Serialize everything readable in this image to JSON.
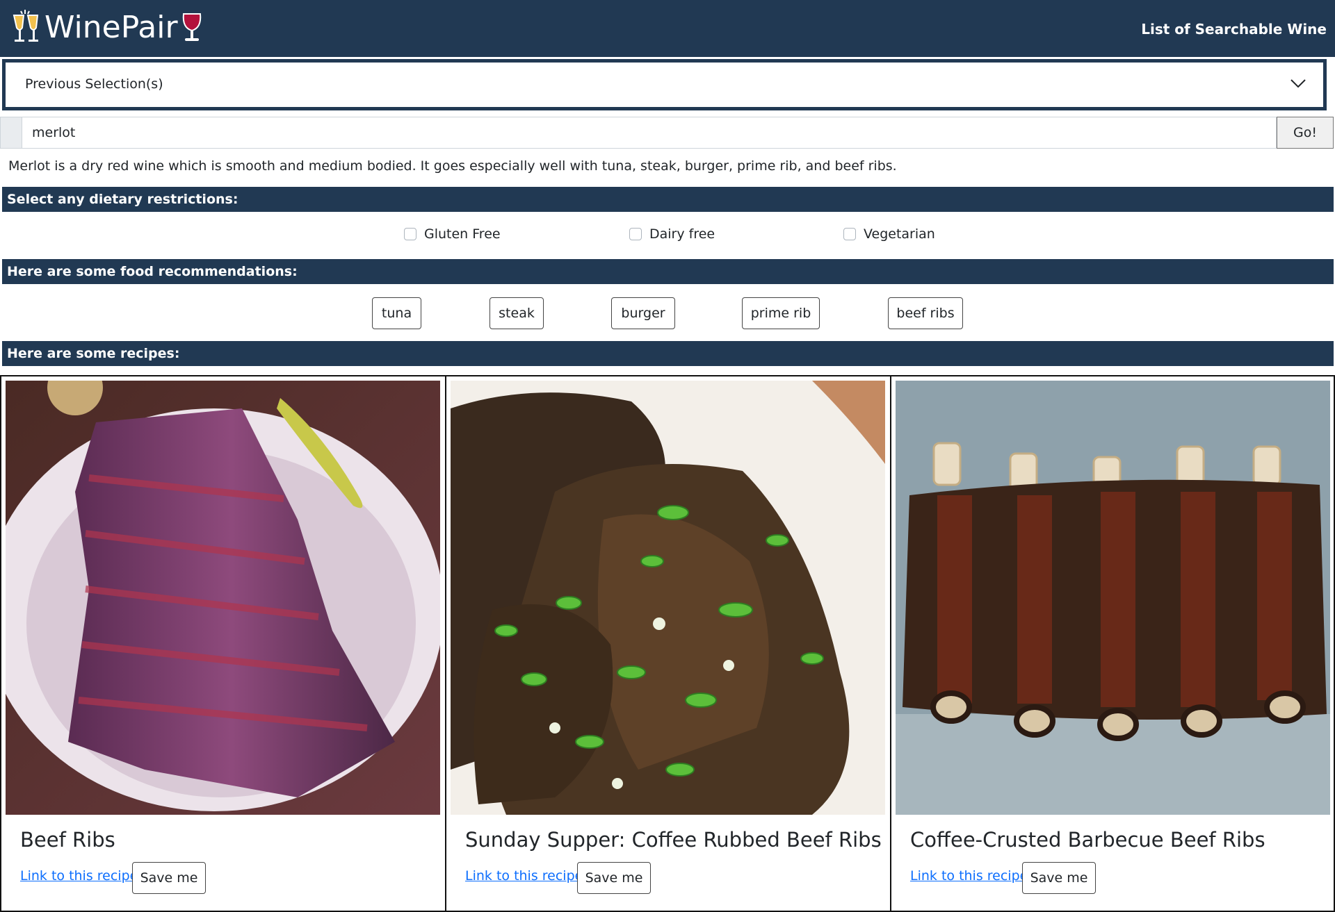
{
  "header": {
    "brand": "WinePair",
    "nav_link": "List of Searchable Wine"
  },
  "previous_selection": {
    "label": "Previous Selection(s)"
  },
  "search": {
    "value": "merlot",
    "go_label": "Go!"
  },
  "description": "Merlot is a dry red wine which is smooth and medium bodied. It goes especially well with tuna, steak, burger, prime rib, and beef ribs.",
  "dietary": {
    "heading": "Select any dietary restrictions:",
    "options": [
      {
        "label": "Gluten Free",
        "checked": false
      },
      {
        "label": "Dairy free",
        "checked": false
      },
      {
        "label": "Vegetarian",
        "checked": false
      }
    ]
  },
  "food": {
    "heading": "Here are some food recommendations:",
    "items": [
      "tuna",
      "steak",
      "burger",
      "prime rib",
      "beef ribs"
    ]
  },
  "recipes": {
    "heading": "Here are some recipes:",
    "cards": [
      {
        "title": "Beef Ribs",
        "link_label": "Link to this recipe",
        "save_label": "Save me"
      },
      {
        "title": "Sunday Supper: Coffee Rubbed Beef Ribs",
        "link_label": "Link to this recipe",
        "save_label": "Save me"
      },
      {
        "title": "Coffee-Crusted Barbecue Beef Ribs",
        "link_label": "Link to this recipe",
        "save_label": "Save me"
      }
    ]
  },
  "colors": {
    "navy": "#213953",
    "link": "#0d6efd"
  }
}
